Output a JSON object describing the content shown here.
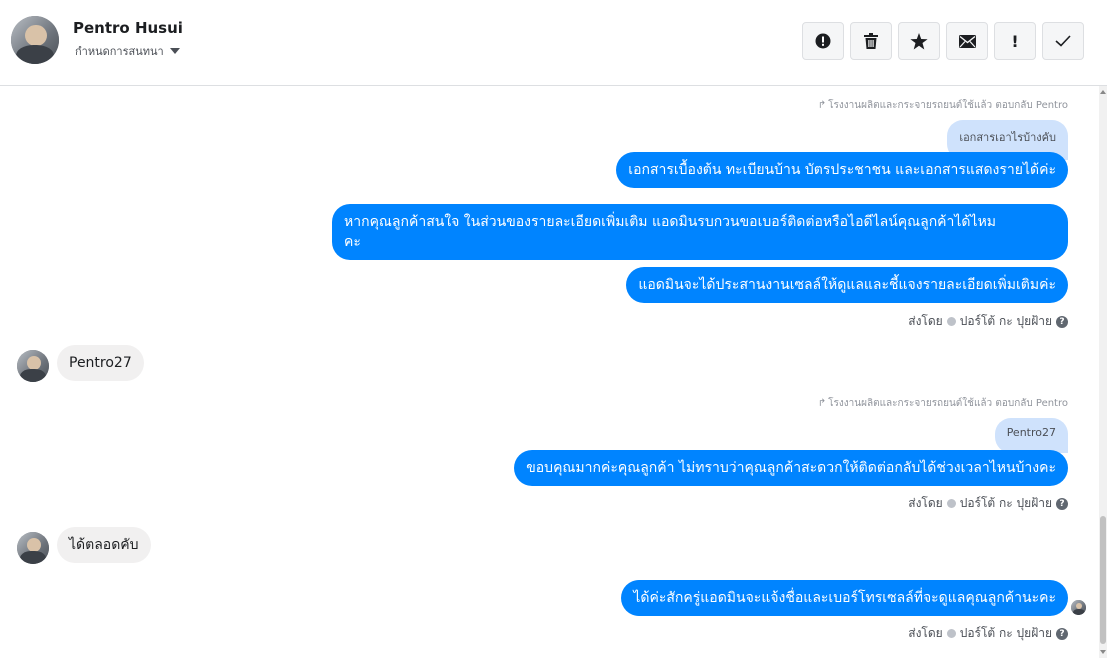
{
  "header": {
    "contact_name": "Pentro Husui",
    "assign_label": "กำหนดการสนทนา",
    "toolbar": [
      {
        "name": "spam-button",
        "icon": "alert-circle-icon"
      },
      {
        "name": "delete-button",
        "icon": "trash-icon"
      },
      {
        "name": "star-button",
        "icon": "star-icon"
      },
      {
        "name": "mark-unread-button",
        "icon": "envelope-icon"
      },
      {
        "name": "follow-up-button",
        "icon": "exclamation-icon",
        "glyph": "!"
      },
      {
        "name": "mark-done-button",
        "icon": "checkmark-icon"
      }
    ]
  },
  "thread": {
    "reply_note_1": "โรงงานผลิตและกระจายรถยนต์ใช้แล้ว ตอบกลับ Pentro",
    "quoted_1": "เอกสารเอาไรบ้างคับ",
    "out_1": "เอกสารเบื้องต้น ทะเบียนบ้าน บัตรประชาชน และเอกสารแสดงรายได้ค่ะ",
    "out_2_line1": "หากคุณลูกค้าสนใจ ในส่วนของรายละเอียดเพิ่มเติม แอดมินรบกวนขอเบอร์ติดต่อหรือไอดีไลน์คุณลูกค้าได้ไหม",
    "out_2_line2": "คะ",
    "out_3": "แอดมินจะได้ประสานงานเซลล์ให้ดูแลและชี้แจงรายละเอียดเพิ่มเติมค่ะ",
    "sent_by_label": "ส่งโดย",
    "sender_name": "ปอร์โต้ กะ ปุยฝ้าย",
    "help_glyph": "?",
    "in_1": "Pentro27",
    "reply_note_2": "โรงงานผลิตและกระจายรถยนต์ใช้แล้ว ตอบกลับ Pentro",
    "quoted_2": "Pentro27",
    "out_4": "ขอบคุณมากค่ะคุณลูกค้า ไม่ทราบว่าคุณลูกค้าสะดวกให้ติดต่อกลับได้ช่วงเวลาไหนบ้างคะ",
    "in_2": "ได้ตลอดคับ",
    "out_5": "ได้ค่ะสักครู่แอดมินจะแจ้งชื่อและเบอร์โทรเซลล์ที่จะดูแลคุณลูกค้านะคะ"
  }
}
